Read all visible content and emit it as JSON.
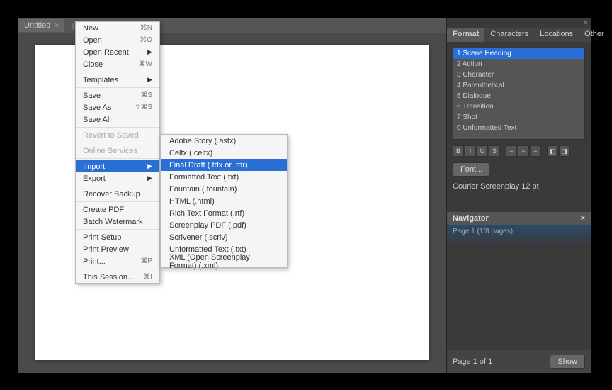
{
  "tab": {
    "title": "Untitled"
  },
  "menu": {
    "new": "New",
    "new_sc": "⌘N",
    "open": "Open",
    "open_sc": "⌘O",
    "open_recent": "Open Recent",
    "close": "Close",
    "close_sc": "⌘W",
    "templates": "Templates",
    "save": "Save",
    "save_sc": "⌘S",
    "save_as": "Save As",
    "save_as_sc": "⇧⌘S",
    "save_all": "Save All",
    "revert": "Revert to Saved",
    "online": "Online Services",
    "import": "Import",
    "export": "Export",
    "recover": "Recover Backup",
    "create_pdf": "Create PDF",
    "batch_watermark": "Batch Watermark",
    "print_setup": "Print Setup",
    "print_preview": "Print Preview",
    "print": "Print...",
    "print_sc": "⌘P",
    "this_session": "This Session...",
    "this_session_sc": "⌘I"
  },
  "import_submenu": {
    "adobe": "Adobe Story (.astx)",
    "celtx": "Celtx (.celtx)",
    "final_draft": "Final Draft (.fdx or .fdr)",
    "formatted": "Formatted Text (.txt)",
    "fountain": "Fountain (.fountain)",
    "html": "HTML (.html)",
    "rtf": "Rich Text Format (.rtf)",
    "pdf": "Screenplay PDF (.pdf)",
    "scrivener": "Scrivener (.scriv)",
    "unformatted": "Unformatted Text (.txt)",
    "xml": "XML (Open Screenplay Format) (.xml)"
  },
  "panel": {
    "tabs": {
      "format": "Format",
      "characters": "Characters",
      "locations": "Locations",
      "other": "Other"
    },
    "elements": {
      "scene": "1 Scene Heading",
      "action": "2 Action",
      "character": "3 Character",
      "paren": "4 Parenthetical",
      "dialogue": "5 Dialogue",
      "transition": "6 Transition",
      "shot": "7 Shot",
      "unformatted": "0 Unformatted Text"
    },
    "toolbar": {
      "b": "B",
      "i": "I",
      "u": "U",
      "s": "S",
      "al": "≡",
      "ac": "≡",
      "ar": "≡",
      "m1": "◧",
      "m2": "◨"
    },
    "font_btn": "Font...",
    "font_label": "Courier Screenplay 12 pt"
  },
  "navigator": {
    "title": "Navigator",
    "page": "Page 1 (1/8 pages)",
    "footer": "Page 1 of 1",
    "show": "Show"
  }
}
